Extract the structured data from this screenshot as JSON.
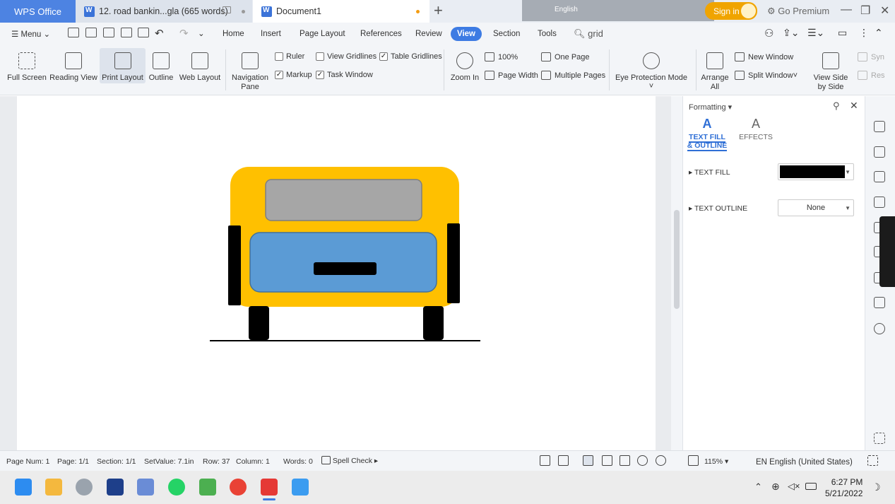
{
  "titlebar": {
    "app_tab": "WPS Office",
    "tabs": [
      {
        "title": "12. road bankin...gla (665 words)"
      },
      {
        "title": "Document1"
      }
    ],
    "tray_text": "English",
    "sign_in": "Sign in",
    "premium": "Go Premium"
  },
  "menubar": {
    "menu": "Menu",
    "items": [
      "Home",
      "Insert",
      "Page Layout",
      "References",
      "Review",
      "View",
      "Section",
      "Tools"
    ],
    "search": "grid"
  },
  "ribbon": {
    "full_screen": "Full Screen",
    "reading_view": "Reading View",
    "print_layout": "Print Layout",
    "outline": "Outline",
    "web_layout": "Web Layout",
    "navigation_pane": "Navigation Pane",
    "ruler": "Ruler",
    "view_gridlines": "View Gridlines",
    "table_gridlines": "Table Gridlines",
    "markup": "Markup",
    "task_window": "Task Window",
    "zoom_in": "Zoom In",
    "zoom_percent": "100%",
    "page_width": "Page Width",
    "one_page": "One Page",
    "multiple_pages": "Multiple Pages",
    "eye_protection": "Eye Protection Mode",
    "arrange_all": "Arrange All",
    "new_window": "New Window",
    "split_window": "Split Window",
    "side_by_side": "View Side by Side",
    "sync": "Syn",
    "reset": "Res"
  },
  "formatting_panel": {
    "title": "Formatting",
    "tab_fill": "TEXT FILL & OUTLINE",
    "tab_effects": "EFFECTS",
    "text_fill": "TEXT FILL",
    "text_outline": "TEXT OUTLINE",
    "outline_value": "None",
    "fill_color": "#000000"
  },
  "statusbar": {
    "page_num": "Page Num: 1",
    "page": "Page: 1/1",
    "section": "Section: 1/1",
    "setvalue": "SetValue: 7.1in",
    "row": "Row: 37",
    "column": "Column: 1",
    "words": "Words: 0",
    "spell_check": "Spell Check",
    "zoom": "115%",
    "language": "EN English (United States)"
  },
  "taskbar": {
    "time": "6:27 PM",
    "date": "5/21/2022"
  },
  "drawing": {
    "bus_body_color": "#ffc000",
    "window_color": "#a6a6a6",
    "front_panel_color": "#5b9bd5"
  }
}
